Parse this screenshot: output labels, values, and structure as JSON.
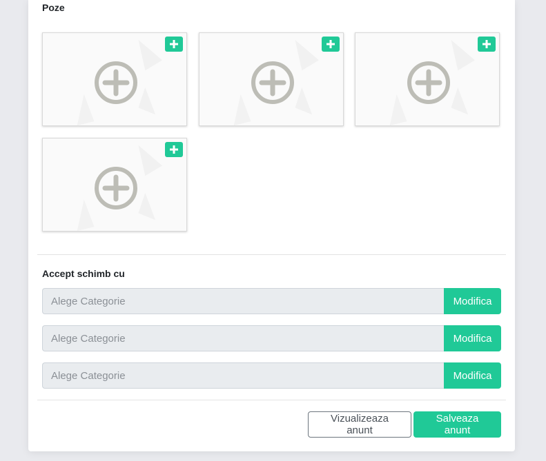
{
  "photos": {
    "title": "Poze",
    "slot_count": 4,
    "add_icon": "plus-icon",
    "placeholder_icon": "plus-circle-icon"
  },
  "exchange": {
    "title": "Accept schimb cu",
    "rows": [
      {
        "placeholder": "Alege Categorie",
        "button_label": "Modifica"
      },
      {
        "placeholder": "Alege Categorie",
        "button_label": "Modifica"
      },
      {
        "placeholder": "Alege Categorie",
        "button_label": "Modifica"
      }
    ]
  },
  "footer": {
    "preview_label": "Vizualizeaza anunt",
    "save_label": "Salveaza anunt"
  },
  "colors": {
    "accent": "#20c997",
    "input_bg": "#e9ecef",
    "page_bg": "#e9eaee"
  }
}
